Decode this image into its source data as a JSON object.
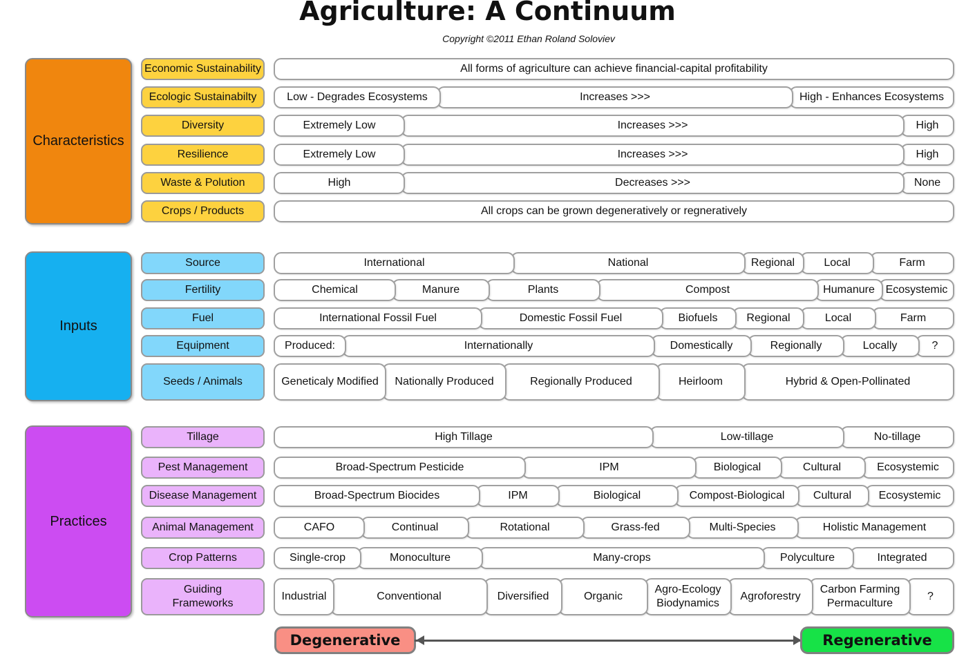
{
  "title": "Agriculture: A Continuum",
  "copyright": "Copyright ©2011 Ethan Roland Soloviev",
  "colors": {
    "characteristics_group": "#f0860e",
    "characteristics_label": "#fdd23f",
    "inputs_group": "#16b0f0",
    "inputs_label": "#82d7fb",
    "practices_group": "#cc4cf2",
    "practices_label": "#eab3fb",
    "degenerative": "#f98f84",
    "regenerative": "#17e247"
  },
  "groups": [
    {
      "name": "Characteristics",
      "rows": [
        {
          "label": "Economic Sustainability",
          "segments": [
            "All forms of agriculture can achieve financial-capital profitability"
          ]
        },
        {
          "label": "Ecologic Sustainabilty",
          "segments": [
            "Low - Degrades Ecosystems",
            "Increases >>>",
            "High - Enhances Ecosystems"
          ]
        },
        {
          "label": "Diversity",
          "segments": [
            "Extremely Low",
            "Increases >>>",
            "High"
          ]
        },
        {
          "label": "Resilience",
          "segments": [
            "Extremely Low",
            "Increases >>>",
            "High"
          ]
        },
        {
          "label": "Waste & Polution",
          "segments": [
            "High",
            "Decreases >>>",
            "None"
          ]
        },
        {
          "label": "Crops / Products",
          "segments": [
            "All crops can be grown degeneratively or regneratively"
          ]
        }
      ]
    },
    {
      "name": "Inputs",
      "rows": [
        {
          "label": "Source",
          "segments": [
            "International",
            "National",
            "Regional",
            "Local",
            "Farm"
          ]
        },
        {
          "label": "Fertility",
          "segments": [
            "Chemical",
            "Manure",
            "Plants",
            "Compost",
            "Humanure",
            "Ecosystemic"
          ]
        },
        {
          "label": "Fuel",
          "segments": [
            "International Fossil Fuel",
            "Domestic Fossil Fuel",
            "Biofuels",
            "Regional",
            "Local",
            "Farm"
          ]
        },
        {
          "label": "Equipment",
          "segments": [
            "Produced:",
            "Internationally",
            "Domestically",
            "Regionally",
            "Locally",
            "?"
          ]
        },
        {
          "label": "Seeds / Animals",
          "segments": [
            "Geneticaly Modified",
            "Nationally Produced",
            "Regionally Produced",
            "Heirloom",
            "Hybrid & Open-Pollinated"
          ]
        }
      ]
    },
    {
      "name": "Practices",
      "rows": [
        {
          "label": "Tillage",
          "segments": [
            "High Tillage",
            "Low-tillage",
            "No-tillage"
          ]
        },
        {
          "label": "Pest Management",
          "segments": [
            "Broad-Spectrum Pesticide",
            "IPM",
            "Biological",
            "Cultural",
            "Ecosystemic"
          ]
        },
        {
          "label": "Disease Management",
          "segments": [
            "Broad-Spectrum Biocides",
            "IPM",
            "Biological",
            "Compost-Biological",
            "Cultural",
            "Ecosystemic"
          ]
        },
        {
          "label": "Animal Management",
          "segments": [
            "CAFO",
            "Continual",
            "Rotational",
            "Grass-fed",
            "Multi-Species",
            "Holistic Management"
          ]
        },
        {
          "label": "Crop Patterns",
          "segments": [
            "Single-crop",
            "Monoculture",
            "Many-crops",
            "Polyculture",
            "Integrated"
          ]
        },
        {
          "label": "Guiding Frameworks",
          "segments": [
            "Industrial",
            "Conventional",
            "Diversified",
            "Organic",
            "Agro-Ecology Biodynamics",
            "Agroforestry",
            "Carbon Farming Permaculture",
            "?"
          ]
        }
      ]
    }
  ],
  "axis": {
    "left": "Degenerative",
    "right": "Regenerative"
  }
}
